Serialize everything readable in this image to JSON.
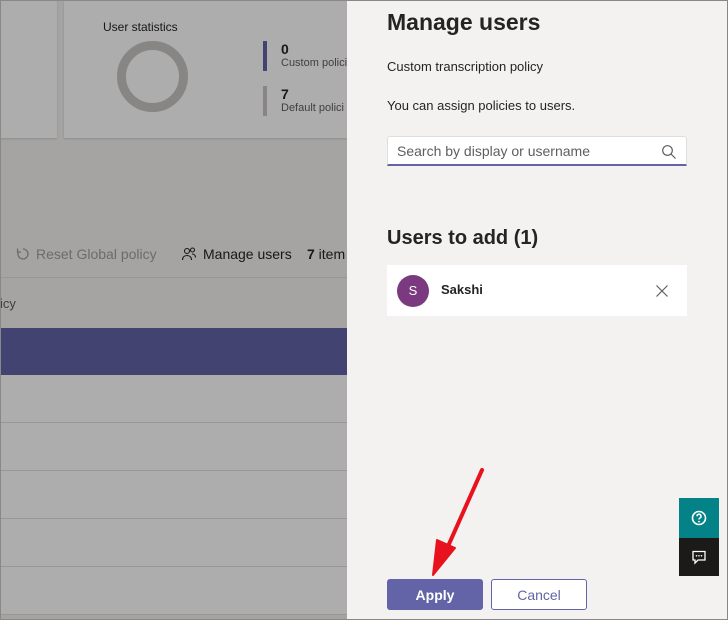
{
  "background": {
    "stats": {
      "title": "User statistics",
      "custom_count": "0",
      "custom_label": "Custom polici",
      "default_count": "7",
      "default_label": "Default polici"
    },
    "toolbar": {
      "reset_label": "Reset Global policy",
      "manage_label": "Manage users",
      "count_number": "7",
      "count_suffix": " item"
    },
    "column_header": "icy"
  },
  "panel": {
    "title": "Manage users",
    "subtitle": "Custom transcription policy",
    "help_text": "You can assign policies to users.",
    "search": {
      "placeholder": "Search by display or username",
      "value": ""
    },
    "users_heading": "Users to add (1)",
    "users": [
      {
        "initial": "S",
        "name": "Sakshi",
        "avatar_color": "#7b3a80"
      }
    ],
    "apply_label": "Apply",
    "cancel_label": "Cancel"
  },
  "colors": {
    "accent": "#6264a7",
    "help_button": "#038387",
    "feedback_button": "#1b1a19",
    "annotation_arrow": "#e8121e"
  },
  "icons": {
    "reset": "reset-icon",
    "manage": "people-icon",
    "search": "search-icon",
    "remove": "close-icon",
    "help": "question-icon",
    "feedback": "feedback-icon"
  }
}
